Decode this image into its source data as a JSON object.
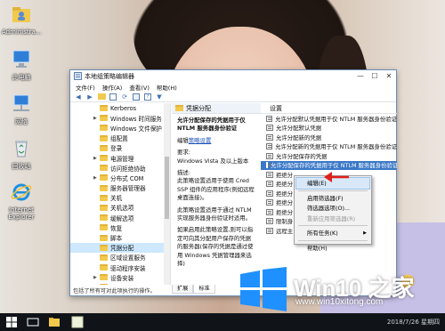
{
  "desktop": {
    "icons": [
      {
        "label": "Administra...",
        "icon": "user-folder-icon"
      },
      {
        "label": "此电脑",
        "icon": "computer-icon"
      },
      {
        "label": "网络",
        "icon": "network-icon"
      },
      {
        "label": "回收站",
        "icon": "recycle-bin-icon"
      },
      {
        "label": "Internet Explorer",
        "icon": "internet-explorer-icon"
      }
    ]
  },
  "window": {
    "title": "本地组策略编辑器",
    "menu": [
      "文件(F)",
      "操作(A)",
      "查看(V)",
      "帮助(H)"
    ],
    "toolbar": [
      "back-arrow-icon",
      "forward-arrow-icon",
      "folder-up-icon",
      "console-tree-icon",
      "refresh-icon",
      "export-icon",
      "help-icon",
      "filter-icon"
    ],
    "tree": [
      {
        "label": "Kerberos",
        "expandable": false,
        "selected": false
      },
      {
        "label": "Windows 时间服务",
        "expandable": true,
        "selected": false
      },
      {
        "label": "Windows 文件保护",
        "expandable": false,
        "selected": false
      },
      {
        "label": "组配置",
        "expandable": false,
        "selected": false
      },
      {
        "label": "登录",
        "expandable": false,
        "selected": false
      },
      {
        "label": "电源管理",
        "expandable": true,
        "selected": false
      },
      {
        "label": "访问拒绝协助",
        "expandable": false,
        "selected": false
      },
      {
        "label": "分布式 COM",
        "expandable": true,
        "selected": false
      },
      {
        "label": "服务器管理器",
        "expandable": false,
        "selected": false
      },
      {
        "label": "关机",
        "expandable": false,
        "selected": false
      },
      {
        "label": "关机选项",
        "expandable": false,
        "selected": false
      },
      {
        "label": "缓解选项",
        "expandable": false,
        "selected": false
      },
      {
        "label": "恢复",
        "expandable": false,
        "selected": false
      },
      {
        "label": "脚本",
        "expandable": false,
        "selected": false
      },
      {
        "label": "凭据分配",
        "expandable": false,
        "selected": true
      },
      {
        "label": "区域设置服务",
        "expandable": false,
        "selected": false
      },
      {
        "label": "驱动程序安装",
        "expandable": false,
        "selected": false
      },
      {
        "label": "设备安装",
        "expandable": true,
        "selected": false
      },
      {
        "label": "设备保护",
        "expandable": false,
        "selected": false
      }
    ],
    "desc_header": "凭据分配",
    "desc": {
      "heading": "允许分配保存的凭据用于仅 NTLM 服务器身份验证",
      "edit_prefix": "编辑",
      "edit_link": "策略设置",
      "req_label": "要求:",
      "req_text": "Windows Vista 及以上版本",
      "desc_label": "描述:",
      "desc_text": "此策略设置适用于使用 Cred SSP 组件的应用程序(例如远程桌面连接)。",
      "para2": "此策略设置适用于通过 NTLM 实现服务器身份验证时适用。",
      "para3": "如果启用此策略设置,则可以指定可向其分配用户保存的凭据的服务器(保存的凭据是通过使用 Windows 凭据管理器来选择)"
    },
    "settings_header": "设置",
    "settings": [
      {
        "label": "允许分配默认凭据用于仅 NTLM 服务器身份验证",
        "selected": false
      },
      {
        "label": "允许分配默认凭据",
        "selected": false
      },
      {
        "label": "允许分配新的凭据",
        "selected": false
      },
      {
        "label": "允许分配新的凭据用于仅 NTLM 服务器身份验证",
        "selected": false
      },
      {
        "label": "允许分配保存的凭据",
        "selected": false
      },
      {
        "label": "允许分配保存的凭据用于仅 NTLM 服务器身份验证",
        "selected": true
      },
      {
        "label": "拒绝分",
        "selected": false
      },
      {
        "label": "拒绝分",
        "selected": false
      },
      {
        "label": "拒绝分",
        "selected": false
      },
      {
        "label": "拒绝分",
        "selected": false
      },
      {
        "label": "拒绝分",
        "selected": false
      },
      {
        "label": "限制身",
        "selected": false
      },
      {
        "label": "远程主",
        "selected": false
      }
    ],
    "tabs": [
      "扩展",
      "标准"
    ],
    "status": "包括了所有可对此项执行的操作。"
  },
  "context_menu": {
    "items": [
      {
        "label": "编辑(E)",
        "highlighted": true,
        "disabled": false,
        "submenu": false
      },
      {
        "sep": true
      },
      {
        "label": "启用筛选器(F)",
        "highlighted": false,
        "disabled": false,
        "submenu": false
      },
      {
        "label": "筛选器选项(O)...",
        "highlighted": false,
        "disabled": false,
        "submenu": false
      },
      {
        "label": "重新应用筛选器(R)",
        "highlighted": false,
        "disabled": true,
        "submenu": false
      },
      {
        "sep": true
      },
      {
        "label": "所有任务(K)",
        "highlighted": false,
        "disabled": false,
        "submenu": true
      },
      {
        "sep": true
      },
      {
        "label": "帮助(H)",
        "highlighted": false,
        "disabled": false,
        "submenu": false
      }
    ]
  },
  "watermark": {
    "title": "Win10 之家",
    "url": "www.win10xitong.com"
  },
  "taskbar": {
    "clock": "2018/7/26 星期四"
  },
  "colors": {
    "selection_blue": "#3a78c7",
    "tree_selection": "#cde8ff",
    "windows_logo_blue": "#1e90ff",
    "taskbar": "#101418"
  }
}
